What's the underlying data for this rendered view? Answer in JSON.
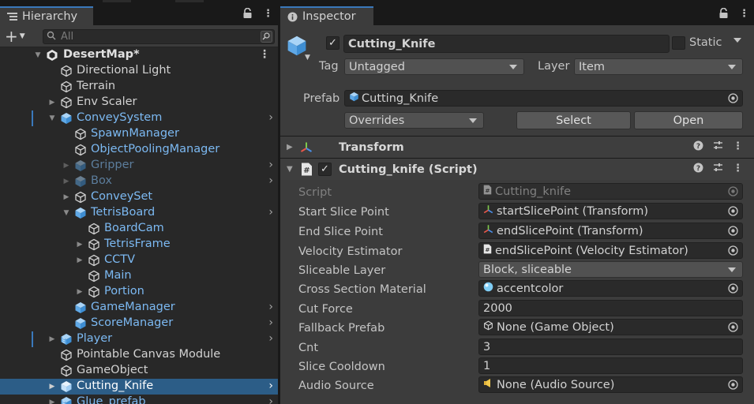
{
  "hierarchy": {
    "tab_title": "Hierarchy",
    "search_placeholder": "All",
    "scene": "DesertMap*",
    "items": [
      {
        "label": "Directional Light",
        "color": "normal",
        "icon": "gameobject"
      },
      {
        "label": "Terrain",
        "color": "normal",
        "icon": "gameobject"
      },
      {
        "label": "Env Scaler",
        "color": "normal",
        "icon": "gameobject"
      },
      {
        "label": "ConveySystem",
        "color": "blue",
        "icon": "prefab"
      },
      {
        "label": "SpawnManager",
        "color": "blue",
        "icon": "gameobject"
      },
      {
        "label": "ObjectPoolingManager",
        "color": "blue",
        "icon": "gameobject"
      },
      {
        "label": "Gripper",
        "color": "dim",
        "icon": "prefab"
      },
      {
        "label": "Box",
        "color": "dim",
        "icon": "prefab"
      },
      {
        "label": "ConveySet",
        "color": "blue",
        "icon": "gameobject"
      },
      {
        "label": "TetrisBoard",
        "color": "blue",
        "icon": "prefab"
      },
      {
        "label": "BoardCam",
        "color": "blue",
        "icon": "gameobject"
      },
      {
        "label": "TetrisFrame",
        "color": "blue",
        "icon": "gameobject"
      },
      {
        "label": "CCTV",
        "color": "blue",
        "icon": "gameobject"
      },
      {
        "label": "Main",
        "color": "blue",
        "icon": "gameobject"
      },
      {
        "label": "Portion",
        "color": "blue",
        "icon": "gameobject"
      },
      {
        "label": "GameManager",
        "color": "blue",
        "icon": "prefab"
      },
      {
        "label": "ScoreManager",
        "color": "blue",
        "icon": "prefab"
      },
      {
        "label": "Player",
        "color": "blue",
        "icon": "prefab-variant"
      },
      {
        "label": "Pointable Canvas Module",
        "color": "normal",
        "icon": "gameobject"
      },
      {
        "label": "GameObject",
        "color": "normal",
        "icon": "gameobject"
      },
      {
        "label": "Cutting_Knife",
        "color": "normal",
        "icon": "prefab",
        "selected": true
      },
      {
        "label": "Glue_prefab",
        "color": "blue",
        "icon": "prefab-variant"
      }
    ]
  },
  "inspector": {
    "tab_title": "Inspector",
    "object_name": "Cutting_Knife",
    "active": true,
    "static_label": "Static",
    "tag_label": "Tag",
    "tag_value": "Untagged",
    "layer_label": "Layer",
    "layer_value": "Item",
    "prefab_label": "Prefab",
    "prefab_value": "Cutting_Knife",
    "overrides_value": "Overrides",
    "select_button": "Select",
    "open_button": "Open",
    "components": [
      {
        "title": "Transform",
        "expanded": false,
        "icon": "transform-icon"
      },
      {
        "title": "Cutting_knife (Script)",
        "expanded": true,
        "icon": "script-icon"
      }
    ],
    "properties": [
      {
        "label": "Script",
        "value": "Cutting_knife",
        "icon": "script-icon",
        "picker": true,
        "disabled": true
      },
      {
        "label": "Start Slice Point",
        "value": "startSlicePoint (Transform)",
        "icon": "transform-icon",
        "picker": true
      },
      {
        "label": "End Slice Point",
        "value": "endSlicePoint (Transform)",
        "icon": "transform-icon",
        "picker": true
      },
      {
        "label": "Velocity Estimator",
        "value": "endSlicePoint (Velocity Estimator)",
        "icon": "script-icon",
        "picker": true
      },
      {
        "label": "Sliceable Layer",
        "value": "Block, sliceable",
        "dropdown": true
      },
      {
        "label": "Cross Section Material",
        "value": "accentcolor",
        "icon": "material-icon",
        "picker": true
      },
      {
        "label": "Cut Force",
        "value": "2000"
      },
      {
        "label": "Fallback Prefab",
        "value": "None (Game Object)",
        "icon": "gameobject-icon",
        "picker": true
      },
      {
        "label": "Cnt",
        "value": "3"
      },
      {
        "label": "Slice Cooldown",
        "value": "1"
      },
      {
        "label": "Audio Source",
        "value": "None (Audio Source)",
        "icon": "audio-icon",
        "picker": true
      }
    ]
  },
  "colors": {
    "accent": "#3a79bb",
    "prefab_blue": "#7cb9f2",
    "selection": "#2c5d87"
  }
}
